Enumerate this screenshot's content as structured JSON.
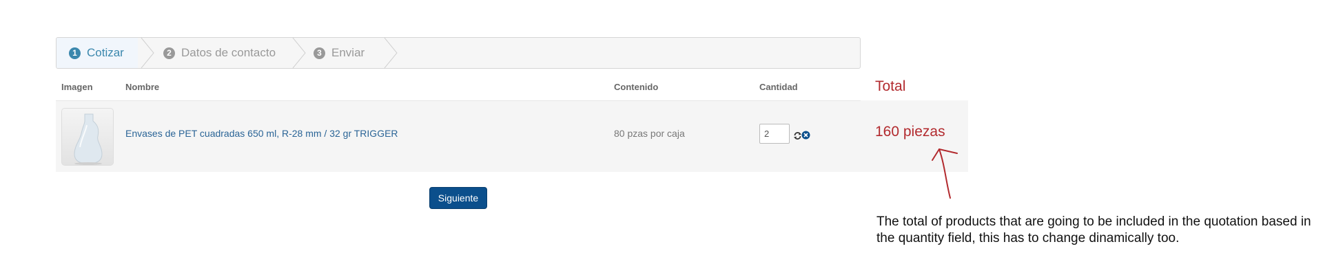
{
  "wizard": {
    "steps": [
      {
        "number": "1",
        "label": "Cotizar",
        "active": true
      },
      {
        "number": "2",
        "label": "Datos de contacto",
        "active": false
      },
      {
        "number": "3",
        "label": "Enviar",
        "active": false
      }
    ]
  },
  "table": {
    "headers": {
      "image": "Imagen",
      "name": "Nombre",
      "content": "Contenido",
      "quantity": "Cantidad"
    },
    "rows": [
      {
        "name": "Envases de PET cuadradas 650 ml, R-28 mm / 32 gr TRIGGER",
        "content": "80 pzas por caja",
        "quantity": "2",
        "image_icon": "bottle-thumbnail",
        "total": "160 piezas"
      }
    ]
  },
  "total_column": {
    "header": "Total"
  },
  "actions": {
    "next_label": "Siguiente"
  },
  "annotation": {
    "note": "The total of products that are going to be included in the quotation based in the quantity field, this has to change dinamically too."
  },
  "colors": {
    "active_step": "#3a87ad",
    "link": "#2a6496",
    "button": "#0b4f8c",
    "annotation_red": "#b22a2e"
  }
}
